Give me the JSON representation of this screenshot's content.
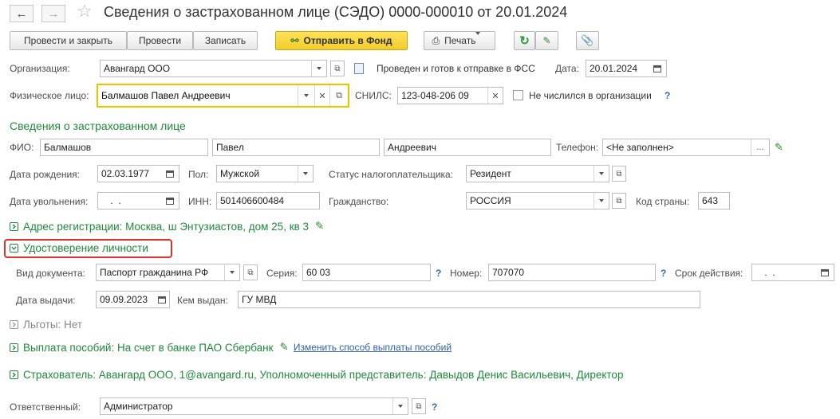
{
  "header": {
    "title": "Сведения о застрахованном лице (СЭДО) 0000-000010 от 20.01.2024"
  },
  "toolbar": {
    "post_close": "Провести и закрыть",
    "post": "Провести",
    "save": "Записать",
    "send": "Отправить в Фонд",
    "print": "Печать"
  },
  "form": {
    "org_label": "Организация:",
    "org_value": "Авангард ООО",
    "status_text": "Проведен и готов к отправке в ФСС",
    "date_label": "Дата:",
    "date_value": "20.01.2024",
    "person_label": "Физическое лицо:",
    "person_value": "Балмашов Павел Андреевич",
    "snils_label": "СНИЛС:",
    "snils_value": "123-048-206 09",
    "not_listed": "Не числился в организации"
  },
  "insured": {
    "heading": "Сведения о застрахованном лице",
    "fio_label": "ФИО:",
    "last_name": "Балмашов",
    "first_name": "Павел",
    "middle_name": "Андреевич",
    "phone_label": "Телефон:",
    "phone_value": "<Не заполнен>",
    "birth_label": "Дата рождения:",
    "birth_value": "02.03.1977",
    "sex_label": "Пол:",
    "sex_value": "Мужской",
    "tax_label": "Статус налогоплательщика:",
    "tax_value": "Резидент",
    "dismiss_label": "Дата увольнения:",
    "dismiss_value": " .  .",
    "inn_label": "ИНН:",
    "inn_value": "501406600484",
    "citizen_label": "Гражданство:",
    "citizen_value": "РОССИЯ",
    "country_label": "Код страны:",
    "country_value": "643"
  },
  "address": {
    "text": "Адрес регистрации: Москва, ш Энтузиастов, дом 25, кв 3"
  },
  "identity": {
    "heading": "Удостоверение личности",
    "doc_label": "Вид документа:",
    "doc_value": "Паспорт гражданина РФ",
    "series_label": "Серия:",
    "series_value": "60 03",
    "number_label": "Номер:",
    "number_value": "707070",
    "valid_label": "Срок действия:",
    "valid_value": " .  .",
    "issue_label": "Дата выдачи:",
    "issue_value": "09.09.2023",
    "issued_by_label": "Кем выдан:",
    "issued_by_value": "ГУ МВД"
  },
  "benefits": {
    "text": "Льготы: Нет"
  },
  "payment": {
    "text": "Выплата пособий: На счет в банке ПАО Сбербанк",
    "change_link": "Изменить способ выплаты пособий"
  },
  "insurer": {
    "text": "Страхователь: Авангард ООО, 1@avangard.ru, Уполномоченный представитель: Давыдов Денис Васильевич, Директор"
  },
  "responsible": {
    "label": "Ответственный:",
    "value": "Администратор"
  },
  "q": "?",
  "colors": {
    "green": "#1e8a3a",
    "accent_yellow": "#f5d53b",
    "highlight_red": "#d9342b",
    "focus_border": "#f0c000"
  }
}
